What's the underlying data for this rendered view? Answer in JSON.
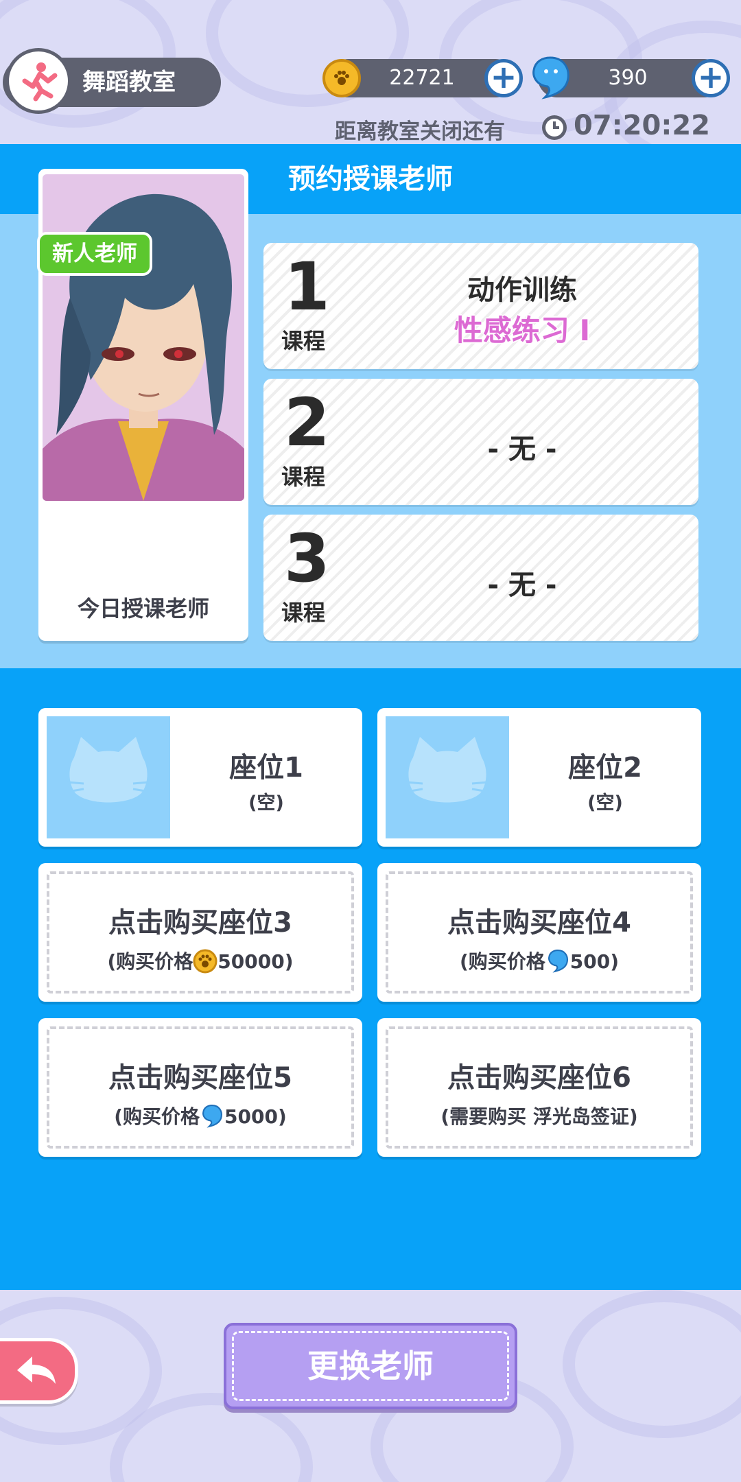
{
  "header": {
    "room_title": "舞蹈教室",
    "coins": "22721",
    "gems": "390",
    "timer_label": "距离教室关闭还有",
    "timer_value": "07:20:22"
  },
  "panel": {
    "title": "预约授课老师"
  },
  "teacher": {
    "badge": "新人老师",
    "caption": "今日授课老师"
  },
  "courses": [
    {
      "num": "1",
      "word": "课程",
      "line1": "动作训练",
      "line2": "性感练习 I"
    },
    {
      "num": "2",
      "word": "课程",
      "line1": "- 无 -",
      "line2": ""
    },
    {
      "num": "3",
      "word": "课程",
      "line1": "- 无 -",
      "line2": ""
    }
  ],
  "seats": [
    {
      "title": "座位1",
      "sub": "(空)"
    },
    {
      "title": "座位2",
      "sub": "(空)"
    }
  ],
  "buy_seats": [
    {
      "title": "点击购买座位3",
      "prefix": "(购买价格",
      "price": "50000)",
      "currency": "coin"
    },
    {
      "title": "点击购买座位4",
      "prefix": "(购买价格",
      "price": "500)",
      "currency": "gem"
    },
    {
      "title": "点击购买座位5",
      "prefix": "(购买价格",
      "price": "5000)",
      "currency": "gem"
    },
    {
      "title": "点击购买座位6",
      "prefix": "(需要购买 浮光岛签证)",
      "price": "",
      "currency": "none"
    }
  ],
  "footer": {
    "change_teacher": "更换老师"
  },
  "colors": {
    "panel_blue": "#08a2f8",
    "light_blue": "#8fd1fb",
    "badge_green": "#5cc72e",
    "pink_text": "#dc6ad3",
    "button_purple": "#b59ff2",
    "back_pink": "#f36b83"
  }
}
